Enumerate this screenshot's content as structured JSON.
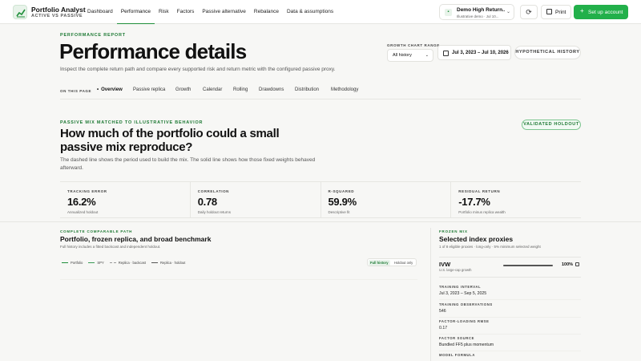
{
  "brand": {
    "title": "Portfolio Analyst",
    "subtitle": "ACTIVE VS PASSIVE",
    "icon": "chart-logo-icon"
  },
  "nav": {
    "items": [
      {
        "label": "Dashboard",
        "active": false
      },
      {
        "label": "Performance",
        "active": true
      },
      {
        "label": "Risk",
        "active": false
      },
      {
        "label": "Factors",
        "active": false
      },
      {
        "label": "Passive alternative",
        "active": false
      },
      {
        "label": "Rebalance",
        "active": false
      },
      {
        "label": "Data & assumptions",
        "active": false
      }
    ]
  },
  "account": {
    "name": "Demo High Return...",
    "sub": "Illustrative demo · Jul 10...",
    "icon": "portfolio-icon"
  },
  "toolbar": {
    "refresh_icon": "refresh-icon",
    "print_label": "Print",
    "setup_label": "Set up account"
  },
  "hero": {
    "eyebrow": "PERFORMANCE REPORT",
    "title": "Performance details",
    "description": "Inspect the complete return path and compare every supported risk and return metric with the configured passive proxy.",
    "range_label": "GROWTH CHART RANGE",
    "range_value": "All history",
    "date_range": "Jul 3, 2023 – Jul 10, 2026",
    "history_button": "HYPOTHETICAL HISTORY"
  },
  "subnav": {
    "label": "ON THIS PAGE",
    "items": [
      "Overview",
      "Passive replica",
      "Growth",
      "Calendar",
      "Rolling",
      "Drawdowns",
      "Distribution",
      "Methodology"
    ],
    "active_index": 0
  },
  "passive_mix": {
    "eyebrow": "PASSIVE MIX MATCHED TO ILLUSTRATIVE BEHAVIOR",
    "title": "How much of the portfolio could a small passive mix reproduce?",
    "description": "The dashed line shows the period used to build the mix. The solid line shows how those fixed weights behaved afterward.",
    "badge": "VALIDATED HOLDOUT",
    "stats": [
      {
        "label": "TRACKING ERROR",
        "value": "16.2%",
        "note": "Annualized holdout"
      },
      {
        "label": "CORRELATION",
        "value": "0.78",
        "note": "Daily holdout returns"
      },
      {
        "label": "R-SQUARED",
        "value": "59.9%",
        "note": "Descriptive fit"
      },
      {
        "label": "RESIDUAL RETURN",
        "value": "-17.7%",
        "note": "Portfolio minus replica wealth"
      }
    ]
  },
  "comparable_path": {
    "eyebrow": "COMPLETE COMPARABLE PATH",
    "title": "Portfolio, frozen replica, and broad benchmark",
    "description": "Full history includes a fitted backcast and independent holdout.",
    "legend": [
      {
        "label": "Portfolio",
        "color": "#1f8f3a",
        "style": "solid"
      },
      {
        "label": "SPY",
        "color": "#3a9a55",
        "style": "solid"
      },
      {
        "label": "Replica · backcast",
        "color": "#999999",
        "style": "dashed"
      },
      {
        "label": "Replica · holdout",
        "color": "#555555",
        "style": "solid"
      }
    ],
    "toggle": [
      "Full history",
      "Holdout only"
    ],
    "toggle_active": 0
  },
  "frozen_mix": {
    "eyebrow": "FROZEN MIX",
    "title": "Selected index proxies",
    "description": "1 of 8 eligible proxies · long-only · 5% minimum selected weight",
    "proxy": {
      "ticker": "IVW",
      "desc": "U.S. large-cap growth",
      "weight_pct": 100,
      "weight_label": "100%"
    },
    "meta": [
      {
        "label": "TRAINING INTERVAL",
        "value": "Jul 3, 2023 – Sep 5, 2025"
      },
      {
        "label": "TRAINING OBSERVATIONS",
        "value": "546"
      },
      {
        "label": "FACTOR-LOADING RMSE",
        "value": "0.17"
      },
      {
        "label": "FACTOR SOURCE",
        "value": "Bundled FF5 plus momentum"
      },
      {
        "label": "MODEL FORMULA",
        "value": ""
      }
    ]
  },
  "colors": {
    "accent": "#22b04a",
    "accent_dark": "#1f7a35",
    "background": "#f7f7f5"
  }
}
